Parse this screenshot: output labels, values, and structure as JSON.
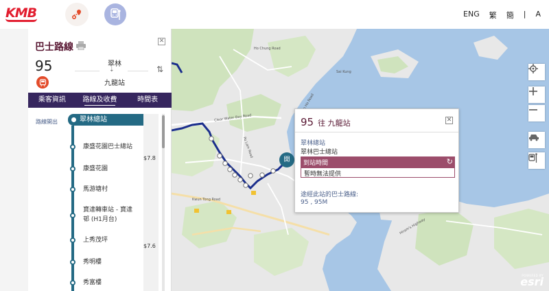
{
  "header": {
    "logo": "KMB",
    "languages": [
      "ENG",
      "繁",
      "簡",
      "|",
      "A"
    ]
  },
  "panel": {
    "title": "巴士路線",
    "route_number": "95",
    "from": "翠林",
    "to": "九龍站",
    "tabs": [
      "乘客資訊",
      "路線及收費",
      "時間表"
    ],
    "active_tab": 1,
    "start_label": "路線開出",
    "start_stop": "翠林總站",
    "stops": [
      "康盛花園巴士總站",
      "康盛花園",
      "馬游塘村",
      "寶達轉車站 - 寶達",
      "邨 (H1月台)",
      "上秀茂坪",
      "秀明樓",
      "秀富樓"
    ],
    "fares": [
      "$7.8",
      "$7.6"
    ]
  },
  "popup": {
    "route": "95",
    "direction": "往 九龍站",
    "stop_name": "翠林總站",
    "stop_full": "翠林巴士總站",
    "eta_label": "到站時間",
    "eta_value": "暫時無法提供",
    "passing_label": "途經此站的巴士路線:",
    "passing_routes": "95 , 95M"
  },
  "map": {
    "marker_label": "開",
    "labels": {
      "ho_chung": "Ho Chung Road",
      "clear_water_bay": "Clear Water Bay Road",
      "po_lam": "Po Lam Road",
      "tai_wan": "Tai Wan Ho Road",
      "sai_kung": "Sai Kung",
      "kwun_tong": "Kwun Tong Road",
      "hiram": "Hiram's Highway"
    },
    "attribution_top": "POWERED BY",
    "attribution": "esri"
  },
  "colors": {
    "brand_red": "#e21d2f",
    "panel_purple": "#36265e",
    "route_teal": "#246a84",
    "eta_bar": "#9c4d6b",
    "title_maroon": "#5a1934"
  }
}
